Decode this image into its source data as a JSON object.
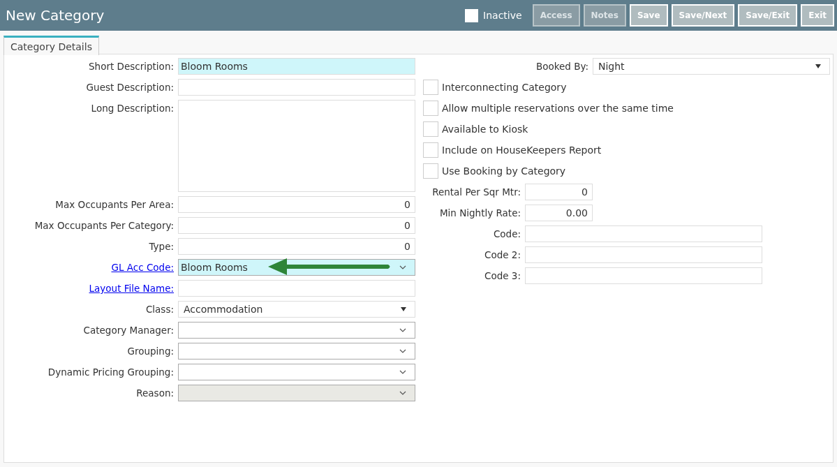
{
  "window": {
    "title": "New Category"
  },
  "header": {
    "inactive": {
      "label": "Inactive",
      "checked": false
    },
    "buttons": [
      {
        "label": "Access",
        "disabled": true
      },
      {
        "label": "Notes",
        "disabled": true
      },
      {
        "label": "Save",
        "disabled": false
      },
      {
        "label": "Save/Next",
        "disabled": false
      },
      {
        "label": "Save/Exit",
        "disabled": false
      },
      {
        "label": "Exit",
        "disabled": false
      }
    ]
  },
  "tabs": [
    {
      "label": "Category Details",
      "selected": true
    }
  ],
  "left_fields": [
    {
      "label": "Short Description:",
      "kind": "text",
      "value": "Bloom Rooms",
      "highlighted": true
    },
    {
      "label": "Guest Description:",
      "kind": "text"
    },
    {
      "label": "Long Description:",
      "kind": "textarea"
    },
    {
      "label": "Max Occupants Per Area:",
      "kind": "number",
      "value": "0"
    },
    {
      "label": "Max Occupants Per Category:",
      "kind": "number",
      "value": "0"
    },
    {
      "label": "Type:",
      "kind": "number",
      "value": "0"
    },
    {
      "label": "GL Acc Code:",
      "kind": "combo",
      "value": "Bloom Rooms",
      "highlighted": true,
      "link": true,
      "annotated": true
    },
    {
      "label": "Layout File Name:",
      "kind": "text",
      "link": true
    },
    {
      "label": "Class:",
      "kind": "select",
      "value": "Accommodation"
    },
    {
      "label": "Category Manager:",
      "kind": "combo"
    },
    {
      "label": "Grouping:",
      "kind": "combo"
    },
    {
      "label": "Dynamic Pricing Grouping:",
      "kind": "combo"
    },
    {
      "label": "Reason:",
      "kind": "combo",
      "disabled": true
    }
  ],
  "right_fields": [
    {
      "label": "Booked By:",
      "kind": "select",
      "value": "Night"
    },
    {
      "label": "Interconnecting Category",
      "kind": "checkbox",
      "checked": false
    },
    {
      "label": "Allow multiple reservations over the same time",
      "kind": "checkbox",
      "checked": false
    },
    {
      "label": "Available to Kiosk",
      "kind": "checkbox",
      "checked": false
    },
    {
      "label": "Include on HouseKeepers Report",
      "kind": "checkbox",
      "checked": false
    },
    {
      "label": "Use Booking by Category",
      "kind": "checkbox",
      "checked": false
    },
    {
      "label": "Rental Per Sqr Mtr:",
      "kind": "short-number",
      "value": "0"
    },
    {
      "label": "Min Nightly Rate:",
      "kind": "short-number",
      "value": "0.00"
    },
    {
      "label": "Code:",
      "kind": "text"
    },
    {
      "label": "Code 2:",
      "kind": "text"
    },
    {
      "label": "Code 3:",
      "kind": "text"
    }
  ]
}
